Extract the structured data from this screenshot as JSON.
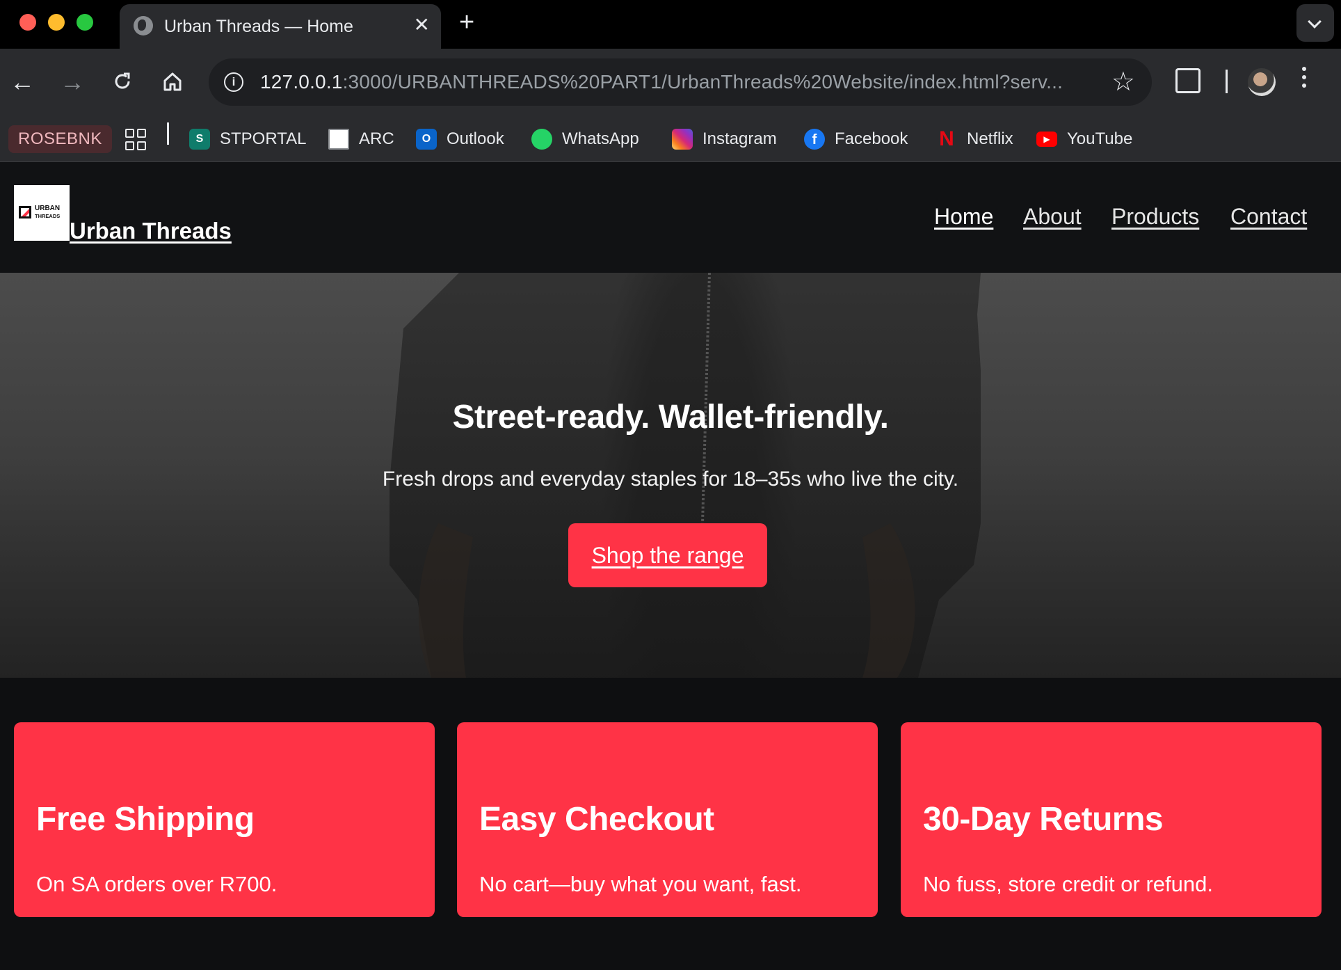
{
  "browser": {
    "tab_title": "Urban Threads — Home",
    "tab_close": "✕",
    "new_tab": "+",
    "url_host": "127.0.0.1",
    "url_rest": ":3000/URBANTHREADS%20PART1/UrbanThreads%20Website/index.html?serv...",
    "info_glyph": "i",
    "star_glyph": "☆",
    "back_glyph": "←",
    "forward_glyph": "→"
  },
  "bookmarks": {
    "profile_chip": "ROSEBNK",
    "items": [
      {
        "label": "STPORTAL",
        "color": "#0f7c6b"
      },
      {
        "label": "ARC",
        "color": "#ffffff"
      },
      {
        "label": "Outlook",
        "color": "#0a64c9"
      },
      {
        "label": "WhatsApp",
        "color": "#25d366"
      },
      {
        "label": "Instagram",
        "color": "#d62976"
      },
      {
        "label": "Facebook",
        "color": "#1877f2"
      },
      {
        "label": "Netflix",
        "color": "#e50914"
      },
      {
        "label": "YouTube",
        "color": "#ff0000"
      }
    ]
  },
  "site": {
    "logo_line1": "URBAN",
    "logo_line2": "THREADS",
    "brand": "Urban Threads",
    "nav": [
      "Home",
      "About",
      "Products",
      "Contact"
    ],
    "accent": "#ff3346"
  },
  "hero": {
    "title": "Street-ready. Wallet-friendly.",
    "subtitle": "Fresh drops and everyday staples for 18–35s who live the city.",
    "cta": "Shop the range"
  },
  "features": [
    {
      "title": "Free Shipping",
      "text": "On SA orders over R700."
    },
    {
      "title": "Easy Checkout",
      "text": "No cart—buy what you want, fast."
    },
    {
      "title": "30-Day Returns",
      "text": "No fuss, store credit or refund."
    }
  ]
}
